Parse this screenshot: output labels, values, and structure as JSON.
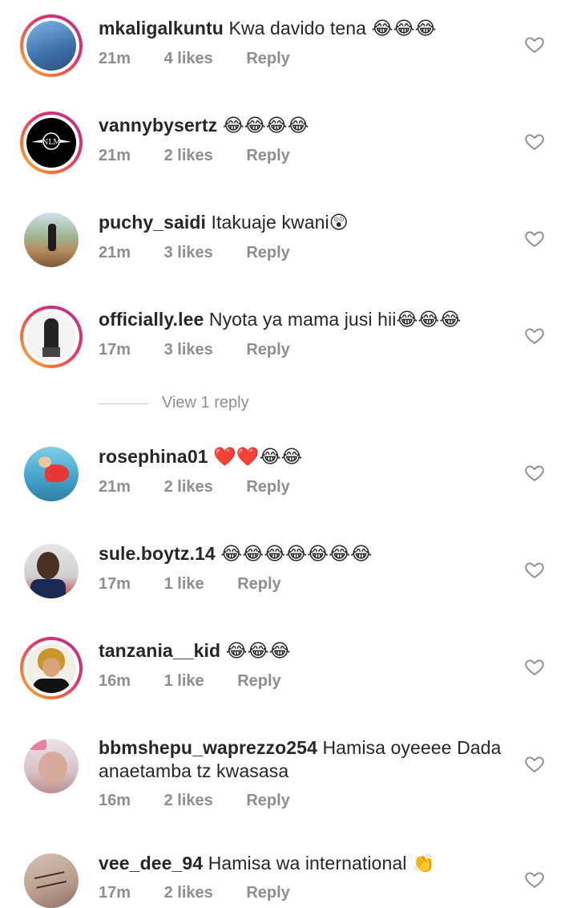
{
  "comments": [
    {
      "username": "mkaligalkuntu",
      "text": "Kwa davido tena",
      "emoji": "😂😂😂",
      "time": "21m",
      "likes": "4 likes",
      "reply": "Reply"
    },
    {
      "username": "vannybysertz",
      "text": "",
      "emoji": "😂😂😂😂",
      "time": "21m",
      "likes": "2 likes",
      "reply": "Reply",
      "avatar_text": "NLM"
    },
    {
      "username": "puchy_saidi",
      "text": "Itakuaje kwani",
      "emoji": "😲",
      "time": "21m",
      "likes": "3 likes",
      "reply": "Reply"
    },
    {
      "username": "officially.lee",
      "text": "Nyota ya mama jusi hii",
      "emoji": "😂😂😂",
      "time": "17m",
      "likes": "3 likes",
      "reply": "Reply"
    },
    {
      "username": "rosephina01",
      "text": "",
      "emoji": "❤️❤️😂😂",
      "time": "21m",
      "likes": "2 likes",
      "reply": "Reply"
    },
    {
      "username": "sule.boytz.14",
      "text": "",
      "emoji": "😂😂😂😂😂😂😂",
      "time": "17m",
      "likes": "1 like",
      "reply": "Reply"
    },
    {
      "username": "tanzania__kid",
      "text": "",
      "emoji": "😂😂😂",
      "time": "16m",
      "likes": "1 like",
      "reply": "Reply"
    },
    {
      "username": "bbmshepu_waprezzo254",
      "text": "Hamisa oyeeee Dada anaetamba tz kwasasa",
      "emoji": "",
      "time": "16m",
      "likes": "2 likes",
      "reply": "Reply"
    },
    {
      "username": "vee_dee_94",
      "text": "Hamisa wa international",
      "emoji": "👏",
      "time": "17m",
      "likes": "2 likes",
      "reply": "Reply"
    }
  ],
  "view_replies": "View 1 reply",
  "icons": {
    "heart": "heart-outline-icon"
  },
  "colors": {
    "text": "#262626",
    "meta": "#8e8e8e",
    "heart": "#8e8e8e",
    "story_ring": "#e1306c"
  }
}
